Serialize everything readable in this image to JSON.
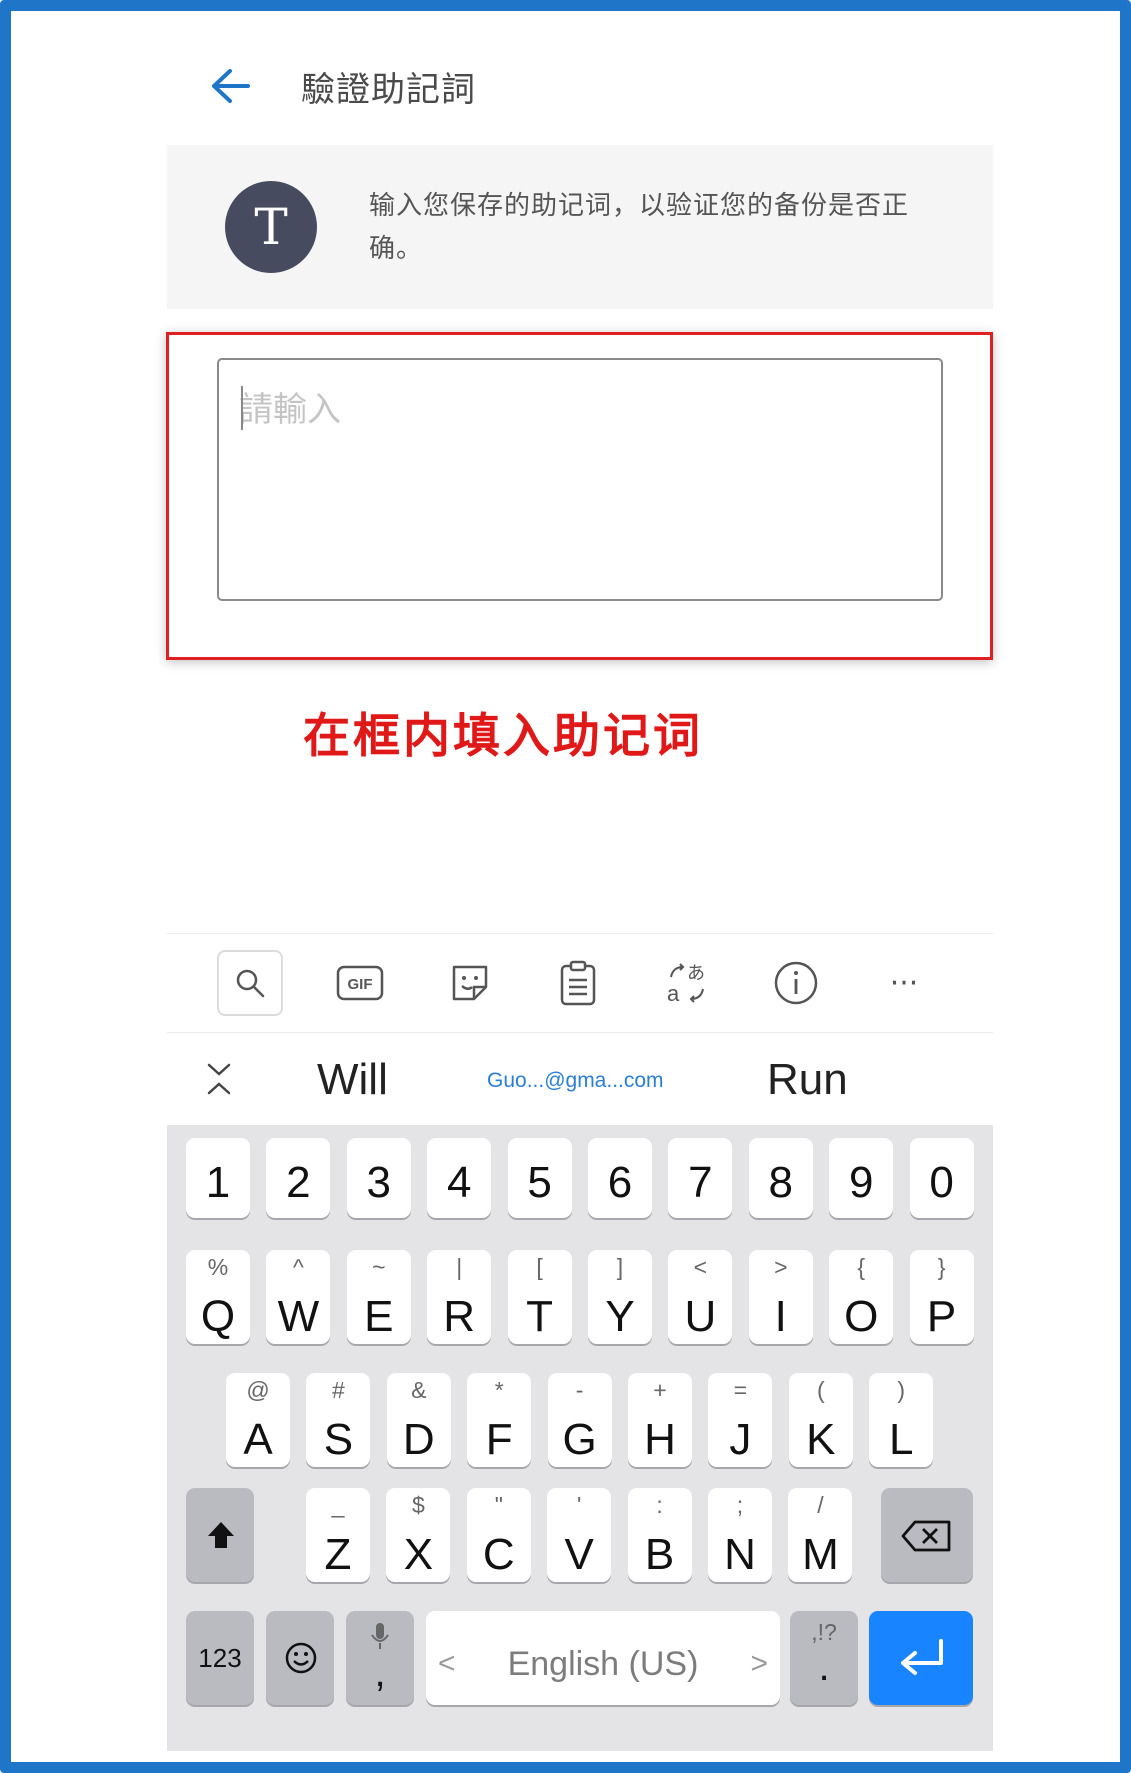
{
  "header": {
    "title": "驗證助記詞"
  },
  "info": {
    "avatar_letter": "T",
    "text": "输入您保存的助记词，以验证您的备份是否正确。"
  },
  "input": {
    "placeholder": "請輸入",
    "value": ""
  },
  "annotation": "在框内填入助记词",
  "toolbar": {
    "items": [
      {
        "icon": "search-icon"
      },
      {
        "icon": "gif-icon",
        "label": "GIF"
      },
      {
        "icon": "sticker-icon"
      },
      {
        "icon": "clipboard-icon"
      },
      {
        "icon": "translate-icon"
      },
      {
        "icon": "info-icon"
      },
      {
        "icon": "more-icon",
        "label": "···"
      }
    ]
  },
  "suggestions": {
    "left": "Will",
    "middle": "Guo...@gma...com",
    "right": "Run"
  },
  "keyboard": {
    "number_row": [
      "1",
      "2",
      "3",
      "4",
      "5",
      "6",
      "7",
      "8",
      "9",
      "0"
    ],
    "row1": [
      {
        "main": "Q",
        "sym": "%"
      },
      {
        "main": "W",
        "sym": "^"
      },
      {
        "main": "E",
        "sym": "~"
      },
      {
        "main": "R",
        "sym": "|"
      },
      {
        "main": "T",
        "sym": "["
      },
      {
        "main": "Y",
        "sym": "]"
      },
      {
        "main": "U",
        "sym": "<"
      },
      {
        "main": "I",
        "sym": ">"
      },
      {
        "main": "O",
        "sym": "{"
      },
      {
        "main": "P",
        "sym": "}"
      }
    ],
    "row2": [
      {
        "main": "A",
        "sym": "@"
      },
      {
        "main": "S",
        "sym": "#"
      },
      {
        "main": "D",
        "sym": "&"
      },
      {
        "main": "F",
        "sym": "*"
      },
      {
        "main": "G",
        "sym": "-"
      },
      {
        "main": "H",
        "sym": "+"
      },
      {
        "main": "J",
        "sym": "="
      },
      {
        "main": "K",
        "sym": "("
      },
      {
        "main": "L",
        "sym": ")"
      }
    ],
    "row3": [
      {
        "main": "Z",
        "sym": "_"
      },
      {
        "main": "X",
        "sym": "$"
      },
      {
        "main": "C",
        "sym": "\""
      },
      {
        "main": "V",
        "sym": "'"
      },
      {
        "main": "B",
        "sym": ":"
      },
      {
        "main": "N",
        "sym": ";"
      },
      {
        "main": "M",
        "sym": "/"
      }
    ],
    "bottom": {
      "numbers_label": "123",
      "comma": ",",
      "space_label": "English (US)",
      "space_left": "<",
      "space_right": ">",
      "period": ".",
      "period_sym": ",!?"
    }
  },
  "colors": {
    "accent": "#1f76c9",
    "enter": "#1884ff",
    "annotation": "#e01818"
  }
}
